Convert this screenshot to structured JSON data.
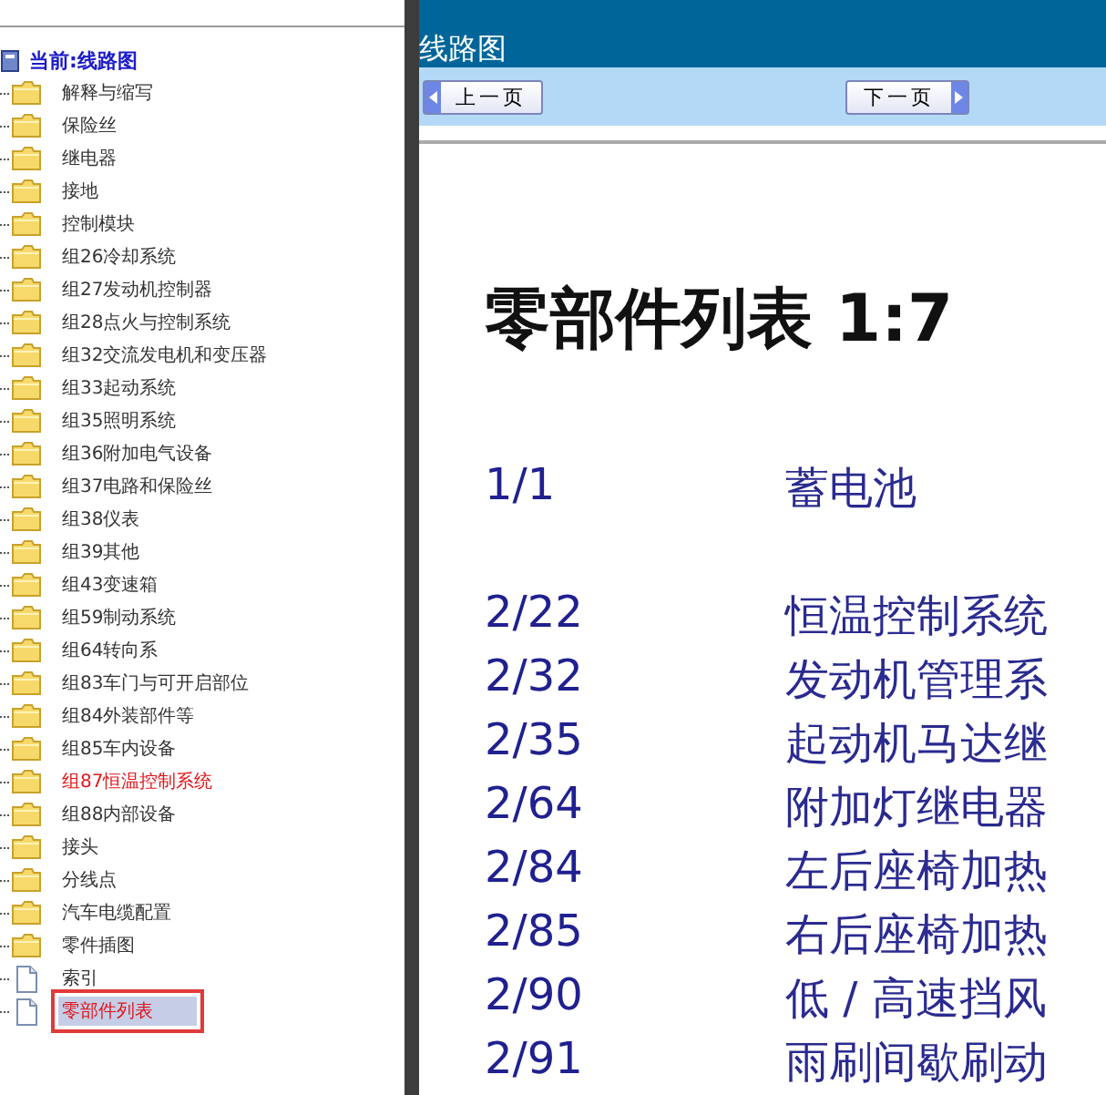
{
  "tree": {
    "current": "当前:线路图",
    "items": [
      {
        "label": "解释与缩写",
        "kind": "folder",
        "marked": false,
        "selected": false
      },
      {
        "label": "保险丝",
        "kind": "folder",
        "marked": false,
        "selected": false
      },
      {
        "label": "继电器",
        "kind": "folder",
        "marked": false,
        "selected": false
      },
      {
        "label": "接地",
        "kind": "folder",
        "marked": false,
        "selected": false
      },
      {
        "label": "控制模块",
        "kind": "folder",
        "marked": false,
        "selected": false
      },
      {
        "label": "组26冷却系统",
        "kind": "folder",
        "marked": false,
        "selected": false
      },
      {
        "label": "组27发动机控制器",
        "kind": "folder",
        "marked": false,
        "selected": false
      },
      {
        "label": "组28点火与控制系统",
        "kind": "folder",
        "marked": false,
        "selected": false
      },
      {
        "label": "组32交流发电机和变压器",
        "kind": "folder",
        "marked": false,
        "selected": false
      },
      {
        "label": "组33起动系统",
        "kind": "folder",
        "marked": false,
        "selected": false
      },
      {
        "label": "组35照明系统",
        "kind": "folder",
        "marked": false,
        "selected": false
      },
      {
        "label": "组36附加电气设备",
        "kind": "folder",
        "marked": false,
        "selected": false
      },
      {
        "label": "组37电路和保险丝",
        "kind": "folder",
        "marked": false,
        "selected": false
      },
      {
        "label": "组38仪表",
        "kind": "folder",
        "marked": false,
        "selected": false
      },
      {
        "label": "组39其他",
        "kind": "folder",
        "marked": false,
        "selected": false
      },
      {
        "label": "组43变速箱",
        "kind": "folder",
        "marked": false,
        "selected": false
      },
      {
        "label": "组59制动系统",
        "kind": "folder",
        "marked": false,
        "selected": false
      },
      {
        "label": "组64转向系",
        "kind": "folder",
        "marked": false,
        "selected": false
      },
      {
        "label": "组83车门与可开启部位",
        "kind": "folder",
        "marked": false,
        "selected": false
      },
      {
        "label": "组84外装部件等",
        "kind": "folder",
        "marked": false,
        "selected": false
      },
      {
        "label": "组85车内设备",
        "kind": "folder",
        "marked": false,
        "selected": false
      },
      {
        "label": "组87恒温控制系统",
        "kind": "folder",
        "marked": true,
        "selected": false
      },
      {
        "label": "组88内部设备",
        "kind": "folder",
        "marked": false,
        "selected": false
      },
      {
        "label": "接头",
        "kind": "folder",
        "marked": false,
        "selected": false
      },
      {
        "label": "分线点",
        "kind": "folder",
        "marked": false,
        "selected": false
      },
      {
        "label": "汽车电缆配置",
        "kind": "folder",
        "marked": false,
        "selected": false
      },
      {
        "label": "零件插图",
        "kind": "folder",
        "marked": false,
        "selected": false
      },
      {
        "label": "索引",
        "kind": "page",
        "marked": false,
        "selected": false
      },
      {
        "label": "零部件列表",
        "kind": "page",
        "marked": true,
        "selected": true
      }
    ]
  },
  "document": {
    "title": "线路图",
    "prev_button": "上一页",
    "next_button": "下一页",
    "heading": "零部件列表 1:7",
    "rows": [
      {
        "ref": "1/1",
        "name": "蓄电池"
      },
      {
        "ref": "2/22",
        "name": "恒温控制系统"
      },
      {
        "ref": "2/32",
        "name": "发动机管理系"
      },
      {
        "ref": "2/35",
        "name": "起动机马达继"
      },
      {
        "ref": "2/64",
        "name": "附加灯继电器"
      },
      {
        "ref": "2/84",
        "name": "左后座椅加热"
      },
      {
        "ref": "2/85",
        "name": "右后座椅加热"
      },
      {
        "ref": "2/90",
        "name": "低 / 高速挡风"
      },
      {
        "ref": "2/91",
        "name": "雨刷间歇刷动"
      }
    ]
  }
}
